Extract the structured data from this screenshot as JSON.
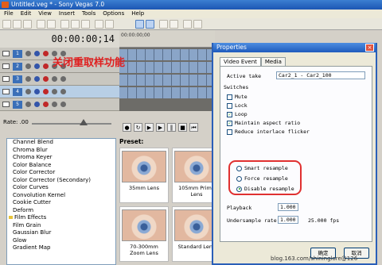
{
  "window": {
    "title": "Untitled.veg * - Sony Vegas 7.0"
  },
  "menu": [
    "File",
    "Edit",
    "View",
    "Insert",
    "Tools",
    "Options",
    "Help"
  ],
  "timecode": "00:00:00;14",
  "timeline": {
    "ruler_text": "00:00:00;00"
  },
  "tracks": [
    "1",
    "2",
    "3",
    "4",
    "5"
  ],
  "rate": {
    "label": "Rate: .00"
  },
  "effects": [
    {
      "label": "Channel Blend",
      "folder": false
    },
    {
      "label": "Chroma Blur",
      "folder": false
    },
    {
      "label": "Chroma Keyer",
      "folder": false
    },
    {
      "label": "Color Balance",
      "folder": false
    },
    {
      "label": "Color Corrector",
      "folder": false
    },
    {
      "label": "Color Corrector (Secondary)",
      "folder": false
    },
    {
      "label": "Color Curves",
      "folder": false
    },
    {
      "label": "Convolution Kernel",
      "folder": false
    },
    {
      "label": "Cookie Cutter",
      "folder": false
    },
    {
      "label": "Deform",
      "folder": false
    },
    {
      "label": "Film Effects",
      "folder": true
    },
    {
      "label": "Film Grain",
      "folder": false
    },
    {
      "label": "Gaussian Blur",
      "folder": false
    },
    {
      "label": "Glow",
      "folder": false
    },
    {
      "label": "Gradient Map",
      "folder": false
    }
  ],
  "presets": {
    "label": "Preset:",
    "items": [
      "35mm Lens",
      "105mm Prime Lens",
      "70-300mm Zoom Lens",
      "Standard Lens"
    ]
  },
  "dialog": {
    "title": "Properties",
    "tabs": [
      "Video Event",
      "Media"
    ],
    "active_take_label": "Active take",
    "active_take_value": "Car2_1 - Car2_100",
    "switches_label": "Switches",
    "switches": [
      {
        "label": "Mute",
        "checked": false
      },
      {
        "label": "Lock",
        "checked": false
      },
      {
        "label": "Loop",
        "checked": true
      },
      {
        "label": "Maintain aspect ratio",
        "checked": true
      },
      {
        "label": "Reduce interlace flicker",
        "checked": false
      }
    ],
    "resample": [
      {
        "label": "Smart resample",
        "selected": false
      },
      {
        "label": "Force resample",
        "selected": false
      },
      {
        "label": "Disable resample",
        "selected": true
      }
    ],
    "playback_label": "Playback",
    "playback_value": "1.000",
    "undersample_label": "Undersample rate:",
    "undersample_value": "1.000",
    "fps": "25.000 fps",
    "ok": "确定",
    "cancel": "取消"
  },
  "annotation": "关闭重取样功能",
  "watermark": "blog.163.com/shininglore@126"
}
